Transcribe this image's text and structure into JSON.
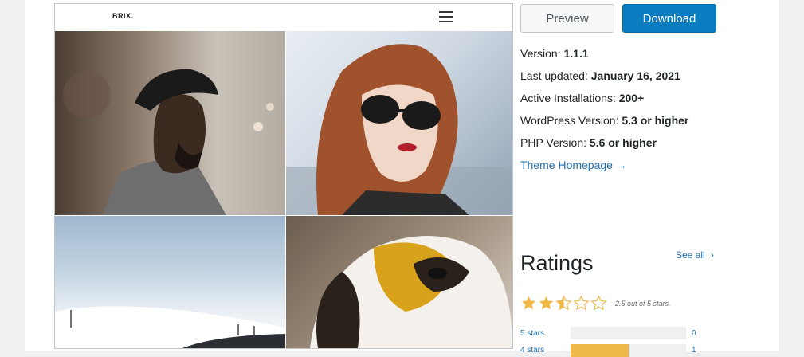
{
  "preview": {
    "brand": "BRIX."
  },
  "actions": {
    "preview_label": "Preview",
    "download_label": "Download"
  },
  "meta": [
    {
      "label": "Version:",
      "value": "1.1.1"
    },
    {
      "label": "Last updated:",
      "value": "January 16, 2021"
    },
    {
      "label": "Active Installations:",
      "value": "200+"
    },
    {
      "label": "WordPress Version:",
      "value": "5.3 or higher"
    },
    {
      "label": "PHP Version:",
      "value": "5.6 or higher"
    }
  ],
  "homepage_link": "Theme Homepage →",
  "ratings": {
    "title": "Ratings",
    "see_all": "See all",
    "summary": "2.5 out of 5 stars.",
    "score": 2.5,
    "rows": [
      {
        "label": "5 stars",
        "count": "0",
        "fraction": 0
      },
      {
        "label": "4 stars",
        "count": "1",
        "fraction": 0.5
      }
    ]
  },
  "colors": {
    "accent": "#0a7cc0",
    "link": "#2271b1",
    "star": "#f0b849"
  }
}
